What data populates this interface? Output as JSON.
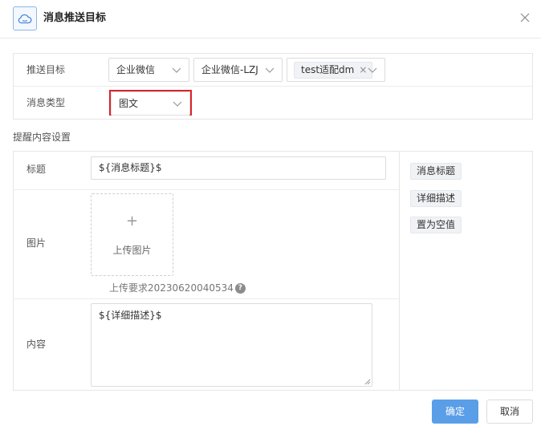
{
  "dialog": {
    "title": "消息推送目标",
    "header_icon": "cloud-icon",
    "close_icon": "close-icon"
  },
  "form": {
    "target": {
      "label": "推送目标",
      "channel_value": "企业微信",
      "account_value": "企业微信-LZJ",
      "selected_tag": "test适配dm"
    },
    "message_type": {
      "label": "消息类型",
      "value": "图文"
    }
  },
  "section": {
    "title": "提醒内容设置"
  },
  "content": {
    "title_label": "标题",
    "title_value": "${消息标题}$",
    "image_label": "图片",
    "upload_plus": "+",
    "upload_label": "上传图片",
    "upload_hint": "上传要求20230620040534",
    "help_glyph": "?",
    "body_label": "内容",
    "body_value": "${详细描述}$"
  },
  "variables": [
    {
      "label": "消息标题"
    },
    {
      "label": "详细描述"
    },
    {
      "label": "置为空值"
    }
  ],
  "footer": {
    "ok_label": "确定",
    "cancel_label": "取消"
  },
  "colors": {
    "primary": "#5b9ee8",
    "highlight_border": "#d9232a"
  }
}
